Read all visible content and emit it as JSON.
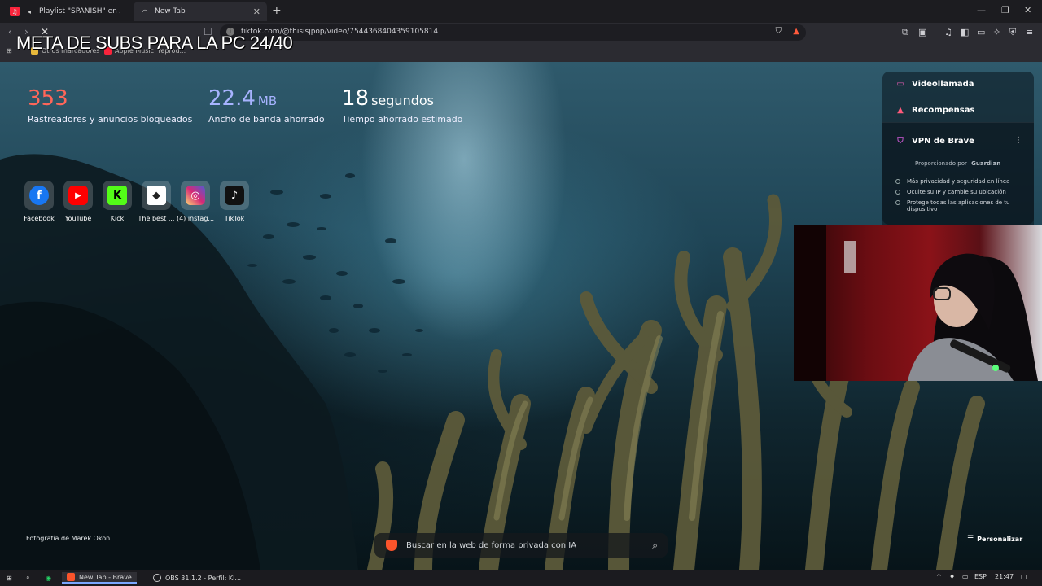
{
  "browser": {
    "tabs": [
      {
        "title": "Playlist \"SPANISH\" en Apple Mu",
        "active": false,
        "icon": "apple-music-icon"
      },
      {
        "title": "New Tab",
        "active": true,
        "icon": "loading-spinner-icon"
      }
    ],
    "url": "tiktok.com/@thisisjpop/video/7544368404359105814",
    "bookmarks": [
      "Otros marcadores",
      "Apple Music: reprod..."
    ]
  },
  "overlay": {
    "meta_text": "META DE SUBS PARA LA PC 24/40"
  },
  "stats": {
    "trackers": {
      "value": "353",
      "label": "Rastreadores y anuncios bloqueados"
    },
    "bandwidth": {
      "value": "22.4",
      "unit": "MB",
      "label": "Ancho de banda ahorrado"
    },
    "time": {
      "value": "18",
      "unit": "segundos",
      "label": "Tiempo ahorrado estimado"
    }
  },
  "top_sites": [
    {
      "name": "Facebook",
      "icon": "facebook-icon",
      "color": "#1877f2",
      "glyph": "f"
    },
    {
      "name": "YouTube",
      "icon": "youtube-icon",
      "color": "#ff0000",
      "glyph": "▶"
    },
    {
      "name": "Kick",
      "icon": "kick-icon",
      "color": "#53fc18",
      "glyph": "K"
    },
    {
      "name": "The best ...",
      "icon": "dice-icon",
      "color": "#2a2a2a",
      "glyph": "⬥"
    },
    {
      "name": "(4) instag...",
      "icon": "instagram-icon",
      "color": "#d62976",
      "glyph": "◎"
    },
    {
      "name": "TikTok",
      "icon": "tiktok-icon",
      "color": "#111111",
      "glyph": "♪"
    }
  ],
  "panel": {
    "video_call": "Videollamada",
    "rewards": "Recompensas",
    "vpn_title": "VPN de Brave",
    "powered_by": "Proporcionado por",
    "powered_brand": "Guardian",
    "bullets": [
      "Más privacidad y seguridad en línea",
      "Oculte su IP y cambie su ubicación",
      "Protege todas las aplicaciones de tu dispositivo"
    ]
  },
  "bottom": {
    "photo_credit": "Fotografía de Marek Okon",
    "search_placeholder": "Buscar en la web de forma privada con IA",
    "personalize": "Personalizar"
  },
  "taskbar": {
    "apps": [
      {
        "label": "New Tab - Brave",
        "active": true
      },
      {
        "label": "OBS 31.1.2 - Perfil: Kl...",
        "active": false
      }
    ],
    "lang": "ESP",
    "clock": "21:47"
  },
  "colors": {
    "trackers": "#ff6659",
    "bandwidth": "#a7b3ff",
    "brave_orange": "#fb542b"
  }
}
